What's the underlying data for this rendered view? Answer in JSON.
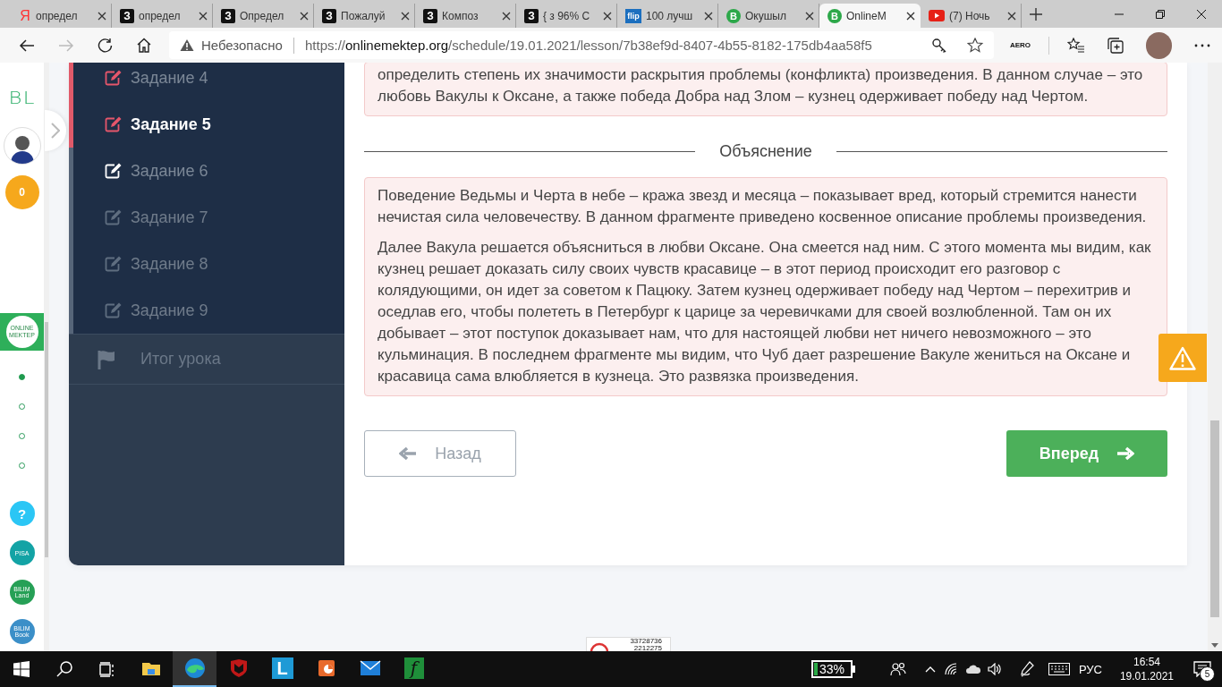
{
  "browser": {
    "tabs": [
      {
        "kind": "yandex",
        "icon_text": "Я",
        "title": "определ",
        "selected": false
      },
      {
        "kind": "letter",
        "icon_text": "З",
        "title": "определ",
        "selected": false
      },
      {
        "kind": "letter",
        "icon_text": "З",
        "title": "Определ",
        "selected": false
      },
      {
        "kind": "letter",
        "icon_text": "З",
        "title": "Пожалуй",
        "selected": false
      },
      {
        "kind": "letter",
        "icon_text": "З",
        "title": "Композ",
        "selected": false
      },
      {
        "kind": "letter",
        "icon_text": "З",
        "title": "{ з 96% С",
        "selected": false
      },
      {
        "kind": "flip",
        "icon_text": "flip",
        "title": "100 лучш",
        "selected": false
      },
      {
        "kind": "bilim",
        "icon_text": "B",
        "title": "Окушыл",
        "selected": false
      },
      {
        "kind": "bilim",
        "icon_text": "B",
        "title": "OnlineM",
        "selected": true
      },
      {
        "kind": "youtube",
        "title": "(7) Ночь",
        "selected": false
      }
    ],
    "address_bar": {
      "security_label": "Небезопасно",
      "url_scheme": "https://",
      "url_host": "onlinemektep.org",
      "url_path": "/schedule/19.01.2021/lesson/7b38ef9d-8407-4b55-8182-175db4aa58f5"
    },
    "extension_label": "AERO"
  },
  "rail": {
    "logo": "BL",
    "score": "0",
    "online_logo": "ONLINE MEKTEP",
    "steps": [
      {
        "completed": true
      },
      {
        "completed": false
      },
      {
        "completed": false
      },
      {
        "completed": false
      }
    ],
    "links": [
      {
        "kind": "help",
        "label": "?"
      },
      {
        "kind": "pisa",
        "label": "PISA"
      },
      {
        "kind": "land",
        "label": "BILIM Land"
      },
      {
        "kind": "book",
        "label": "BILIM Book"
      }
    ]
  },
  "lesson": {
    "tasks": [
      {
        "label": "Задание 4",
        "answered": true,
        "locked": false,
        "selected": false
      },
      {
        "label": "Задание 5",
        "answered": true,
        "locked": false,
        "selected": true
      },
      {
        "label": "Задание 6",
        "answered": false,
        "locked": false,
        "selected": false
      },
      {
        "label": "Задание 7",
        "answered": false,
        "locked": true,
        "selected": false
      },
      {
        "label": "Задание 8",
        "answered": false,
        "locked": true,
        "selected": false
      },
      {
        "label": "Задание 9",
        "answered": false,
        "locked": true,
        "selected": false
      }
    ],
    "summary": {
      "label": "Итог урока"
    },
    "answer_text": "определить степень их значимости раскрытия проблемы (конфликта) произведения. В данном случае – это любовь Вакулы к Оксане, а также победа Добра над Злом – кузнец одерживает победу над Чертом.",
    "explanation_heading": "Объяснение",
    "explanation": [
      "Поведение Ведьмы и Черта в небе – кража звезд и месяца – показывает вред, который стремится нанести нечистая сила человечеству. В данном фрагменте приведено косвенное описание проблемы произведения.",
      "Далее Вакула решается объясниться в любви Оксане. Она смеется над ним. С этого момента мы видим, как кузнец решает доказать силу своих чувств красавице – в этот период происходит его разговор с колядующими, он идет за советом к Пацюку. Затем кузнец одерживает победу над Чертом – перехитрив и оседлав его, чтобы полететь в Петербург к царице за черевичками для своей возлюбленной. Там он их добывает – этот поступок доказывает нам, что для настоящей любви нет ничего невозможного – это кульминация. В последнем фрагменте мы видим, что Чуб дает разрешение Вакуле жениться на Оксане и красавица сама влюбляется в кузнеца. Это развязка произведения."
    ],
    "back_button": {
      "label": "Назад",
      "disabled": true
    },
    "next_button": {
      "label": "Вперед"
    }
  },
  "counter_widget": {
    "lines": [
      "33728736",
      "2212275"
    ]
  },
  "taskbar": {
    "apps": [
      {
        "kind": "explorer",
        "active": false
      },
      {
        "kind": "edge",
        "active": true
      },
      {
        "kind": "shield",
        "active": false
      },
      {
        "kind": "letter",
        "label": "L",
        "active": false
      },
      {
        "kind": "slides",
        "active": false
      },
      {
        "kind": "mail",
        "active": false
      },
      {
        "kind": "formula",
        "label": "f",
        "active": false
      }
    ],
    "battery": "33%",
    "language": "РУС",
    "time": "16:54",
    "date": "19.01.2021",
    "notifications": "5"
  }
}
